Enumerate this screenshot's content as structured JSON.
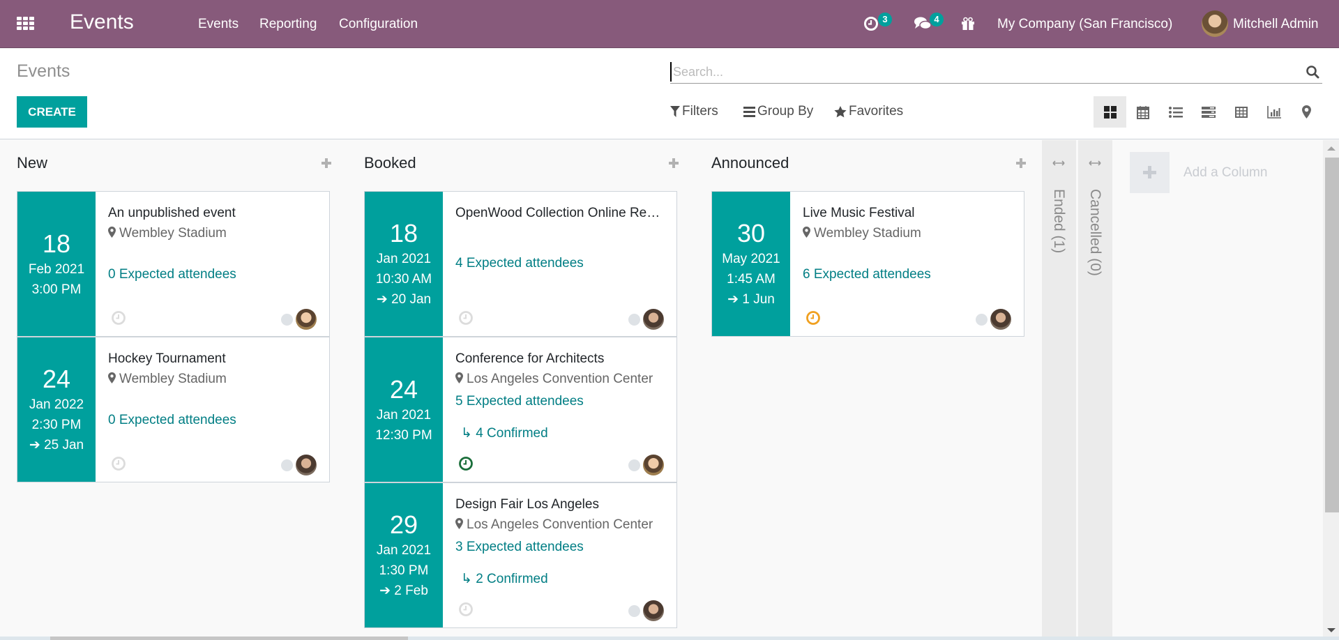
{
  "navbar": {
    "app_title": "Events",
    "menus": [
      "Events",
      "Reporting",
      "Configuration"
    ],
    "activity_count": "3",
    "messages_count": "4",
    "company": "My Company (San Francisco)",
    "user": "Mitchell Admin",
    "icons": [
      "apps-grid-icon",
      "activity-clock-icon",
      "messages-icon",
      "gift-icon"
    ]
  },
  "control_panel": {
    "breadcrumb": "Events",
    "create_label": "CREATE",
    "search_placeholder": "Search...",
    "filters_label": "Filters",
    "groupby_label": "Group By",
    "favorites_label": "Favorites",
    "views": [
      "kanban",
      "calendar",
      "list",
      "gantt",
      "pivot",
      "graph",
      "map"
    ],
    "active_view": "kanban"
  },
  "colors": {
    "brand": "#875a7b",
    "primary": "#00a09d",
    "link": "#017e84",
    "activity_today": "#28a745",
    "activity_planned_green": "#1a6e3a",
    "activity_warning": "#f0a020"
  },
  "columns": [
    {
      "title": "New",
      "cards": [
        {
          "day": "18",
          "month_year": "Feb 2021",
          "time": "3:00 PM",
          "end": "",
          "title": "An unpublished event",
          "location": "Wembley Stadium",
          "attendees": "0 Expected attendees",
          "confirmed": "",
          "activity": "none",
          "avatar": "a"
        },
        {
          "day": "24",
          "month_year": "Jan 2022",
          "time": "2:30 PM",
          "end": "25 Jan",
          "title": "Hockey Tournament",
          "location": "Wembley Stadium",
          "attendees": "0 Expected attendees",
          "confirmed": "",
          "activity": "none",
          "avatar": "b"
        }
      ]
    },
    {
      "title": "Booked",
      "cards": [
        {
          "day": "18",
          "month_year": "Jan 2021",
          "time": "10:30 AM",
          "end": "20 Jan",
          "title": "OpenWood Collection Online Reveal",
          "location": "",
          "attendees": "4 Expected attendees",
          "confirmed": "",
          "activity": "none",
          "avatar": "b"
        },
        {
          "day": "24",
          "month_year": "Jan 2021",
          "time": "12:30 PM",
          "end": "",
          "title": "Conference for Architects",
          "location": "Los Angeles Convention Center",
          "attendees": "5 Expected attendees",
          "confirmed": "4 Confirmed",
          "activity": "planned",
          "avatar": "a"
        },
        {
          "day": "29",
          "month_year": "Jan 2021",
          "time": "1:30 PM",
          "end": "2 Feb",
          "title": "Design Fair Los Angeles",
          "location": "Los Angeles Convention Center",
          "attendees": "3 Expected attendees",
          "confirmed": "2 Confirmed",
          "activity": "none",
          "avatar": "b"
        }
      ]
    },
    {
      "title": "Announced",
      "cards": [
        {
          "day": "30",
          "month_year": "May 2021",
          "time": "1:45 AM",
          "end": "1 Jun",
          "title": "Live Music Festival",
          "location": "Wembley Stadium",
          "attendees": "6 Expected attendees",
          "confirmed": "",
          "activity": "warning",
          "avatar": "b"
        }
      ]
    }
  ],
  "folded_columns": [
    {
      "label": "Ended (1)"
    },
    {
      "label": "Cancelled (0)"
    }
  ],
  "add_column_label": "Add a Column"
}
